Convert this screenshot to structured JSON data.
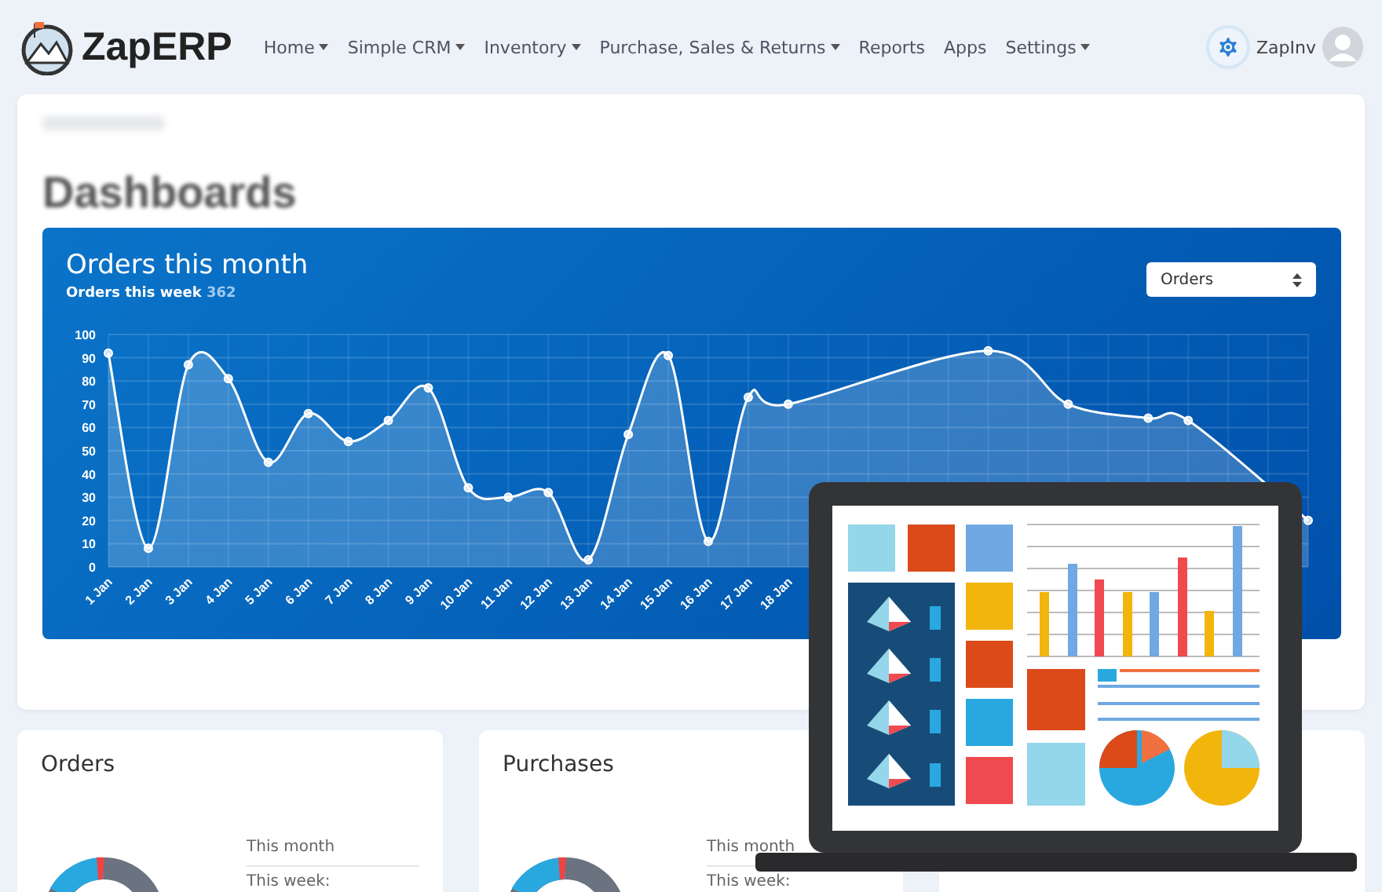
{
  "nav": {
    "brand": "ZapERP",
    "menu": [
      {
        "label": "Home",
        "dropdown": true
      },
      {
        "label": "Simple CRM",
        "dropdown": true
      },
      {
        "label": "Inventory",
        "dropdown": true
      },
      {
        "label": "Purchase, Sales & Returns",
        "dropdown": true
      },
      {
        "label": "Reports",
        "dropdown": false
      },
      {
        "label": "Apps",
        "dropdown": false
      },
      {
        "label": "Settings",
        "dropdown": true
      }
    ],
    "user": "ZapInv"
  },
  "page": {
    "title": "Dashboards"
  },
  "chart_panel": {
    "title": "Orders this month",
    "subtitle": "Orders this week",
    "week_count": "362",
    "select": "Orders",
    "chart_data": {
      "type": "area",
      "categories": [
        "1 Jan",
        "2 Jan",
        "3 Jan",
        "4 Jan",
        "5 Jan",
        "6 Jan",
        "7 Jan",
        "8 Jan",
        "9 Jan",
        "10 Jan",
        "11 Jan",
        "12 Jan",
        "13 Jan",
        "14 Jan",
        "15 Jan",
        "16 Jan",
        "17 Jan",
        "18 Jan",
        null,
        null,
        null,
        null,
        null,
        null,
        null,
        null,
        null,
        null,
        null,
        null,
        null
      ],
      "yticks": [
        0,
        10,
        20,
        30,
        40,
        50,
        60,
        70,
        80,
        90,
        100
      ],
      "grid": true,
      "ylim": [
        0,
        100
      ],
      "values": [
        92,
        8,
        87,
        81,
        45,
        66,
        54,
        63,
        77,
        34,
        30,
        32,
        3,
        57,
        91,
        11,
        73,
        70,
        null,
        null,
        null,
        null,
        93,
        null,
        70,
        null,
        64,
        63,
        null,
        null,
        20
      ]
    }
  },
  "cards": [
    {
      "title": "Orders",
      "rows": [
        "This month",
        "This week:"
      ]
    },
    {
      "title": "Purchases",
      "rows": [
        "This month",
        "This week:"
      ]
    }
  ]
}
